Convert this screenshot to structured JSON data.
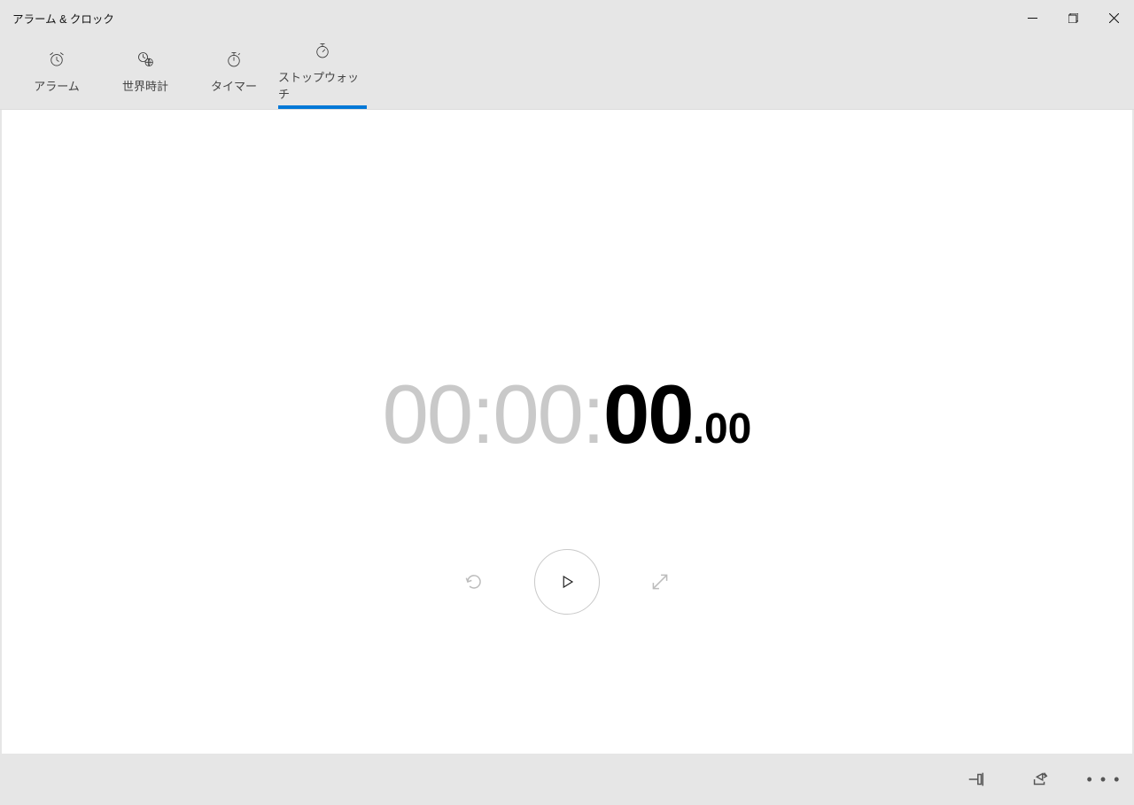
{
  "window": {
    "title": "アラーム & クロック"
  },
  "tabs": {
    "alarm": "アラーム",
    "worldclock": "世界時計",
    "timer": "タイマー",
    "stopwatch": "ストップウォッチ"
  },
  "stopwatch": {
    "hours": "00",
    "minutes": "00",
    "seconds": "00",
    "hundredths": "00",
    "colon": ":",
    "dot": "."
  },
  "bottombar": {
    "more_label": "…"
  }
}
